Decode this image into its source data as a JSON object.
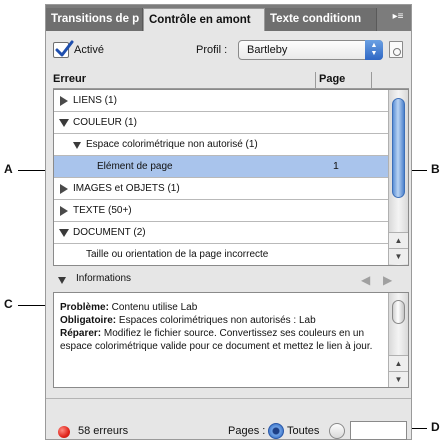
{
  "tabs": [
    {
      "label": "Transitions de p",
      "active": false
    },
    {
      "label": "Contrôle en amont",
      "active": true
    },
    {
      "label": "Texte conditionn",
      "active": false
    }
  ],
  "panel_menu_glyph": "▸≡",
  "active": {
    "label": "Activé",
    "checked": true
  },
  "profile": {
    "label": "Profil :",
    "value": "Bartleby"
  },
  "list": {
    "col_error": "Erreur",
    "col_page": "Page",
    "rows": [
      {
        "label": "LIENS (1)",
        "expanded": false,
        "level": 0,
        "page": ""
      },
      {
        "label": "COULEUR (1)",
        "expanded": true,
        "level": 0,
        "page": ""
      },
      {
        "label": "Espace colorimétrique non autorisé (1)",
        "expanded": true,
        "level": 1,
        "page": ""
      },
      {
        "label": "Elément de page",
        "expanded": null,
        "level": 2,
        "page": "1",
        "selected": true
      },
      {
        "label": "IMAGES et OBJETS (1)",
        "expanded": false,
        "level": 0,
        "page": ""
      },
      {
        "label": "TEXTE (50+)",
        "expanded": false,
        "level": 0,
        "page": ""
      },
      {
        "label": "DOCUMENT (2)",
        "expanded": true,
        "level": 0,
        "page": ""
      },
      {
        "label": "Taille ou orientation de la page incorrecte",
        "expanded": null,
        "level": 1,
        "page": ""
      }
    ]
  },
  "info": {
    "label": "Informations",
    "problem_key": "Problème:",
    "problem_val": " Contenu utilise Lab",
    "required_key": "Obligatoire:",
    "required_val": " Espaces colorimétriques non autorisés : Lab",
    "fix_key": "Réparer:",
    "fix_val": " Modifiez le fichier source. Convertissez ses couleurs en un espace colorimétrique valide pour ce document et mettez le lien à jour."
  },
  "footer": {
    "status_text": "58 erreurs",
    "status_color": "#e0241b",
    "pages_label": "Pages :",
    "all_label": "Toutes",
    "range_value": ""
  },
  "callouts": {
    "a": "A",
    "b": "B",
    "c": "C",
    "d": "D"
  },
  "accent_color": "#3a72c8",
  "selection_color": "#a9c4ec"
}
